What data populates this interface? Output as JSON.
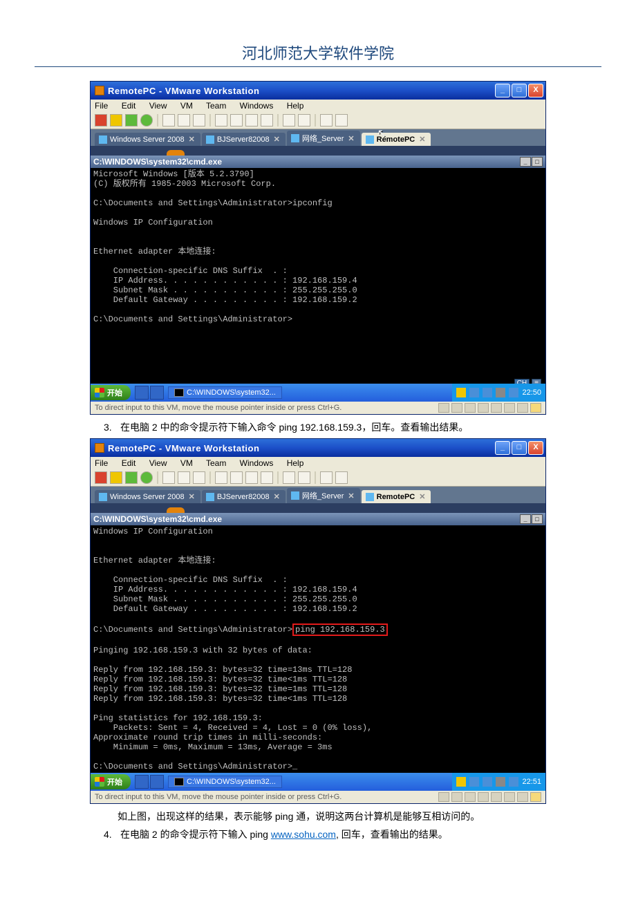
{
  "doc": {
    "header": "河北师范大学软件学院",
    "step3_num": "3.",
    "step3_text": "在电脑 2 中的命令提示符下输入命令 ping 192.168.159.3，回车。查看输出结果。",
    "step3_conclusion": "如上图，出现这样的结果，表示能够 ping 通，说明这两台计算机是能够互相访问的。",
    "step4_num": "4.",
    "step4_text_before": "在电脑 2 的命令提示符下输入 ping ",
    "step4_link": "www.sohu.com",
    "step4_text_after": ", 回车，查看输出的结果。"
  },
  "vm": {
    "title": "RemotePC - VMware Workstation",
    "menus": {
      "file": "File",
      "edit": "Edit",
      "view": "View",
      "vm": "VM",
      "team": "Team",
      "windows": "Windows",
      "help": "Help"
    },
    "tabs": {
      "t1": "Windows Server 2008",
      "t2": "BJServer82008",
      "t3": "网络_Server",
      "t4": "RemotePC",
      "x": "✕"
    },
    "status_text": "To direct input to this VM, move the mouse pointer inside or press Ctrl+G."
  },
  "cmd1": {
    "title": "C:\\WINDOWS\\system32\\cmd.exe",
    "body": "Microsoft Windows [版本 5.2.3790]\n(C) 版权所有 1985-2003 Microsoft Corp.\n\nC:\\Documents and Settings\\Administrator>ipconfig\n\nWindows IP Configuration\n\n\nEthernet adapter 本地连接:\n\n    Connection-specific DNS Suffix  . :\n    IP Address. . . . . . . . . . . . : 192.168.159.4\n    Subnet Mask . . . . . . . . . . . : 255.255.255.0\n    Default Gateway . . . . . . . . . : 192.168.159.2\n\nC:\\Documents and Settings\\Administrator>\n\n\n\n\n\n\n"
  },
  "cmd2": {
    "title": "C:\\WINDOWS\\system32\\cmd.exe",
    "body_top": "Windows IP Configuration\n\n\nEthernet adapter 本地连接:\n\n    Connection-specific DNS Suffix  . :\n    IP Address. . . . . . . . . . . . : 192.168.159.4\n    Subnet Mask . . . . . . . . . . . : 255.255.255.0\n    Default Gateway . . . . . . . . . : 192.168.159.2\n\nC:\\Documents and Settings\\Administrator>",
    "ping_cmd": "ping 192.168.159.3",
    "body_bottom": "\n\nPinging 192.168.159.3 with 32 bytes of data:\n\nReply from 192.168.159.3: bytes=32 time=13ms TTL=128\nReply from 192.168.159.3: bytes=32 time<1ms TTL=128\nReply from 192.168.159.3: bytes=32 time=1ms TTL=128\nReply from 192.168.159.3: bytes=32 time<1ms TTL=128\n\nPing statistics for 192.168.159.3:\n    Packets: Sent = 4, Received = 4, Lost = 0 (0% loss),\nApproximate round trip times in milli-seconds:\n    Minimum = 0ms, Maximum = 13ms, Average = 3ms\n\nC:\\Documents and Settings\\Administrator>_"
  },
  "xp": {
    "start": "开始",
    "task": "C:\\WINDOWS\\system32...",
    "time1": "22:50",
    "time2": "22:51",
    "ch": "CH"
  }
}
